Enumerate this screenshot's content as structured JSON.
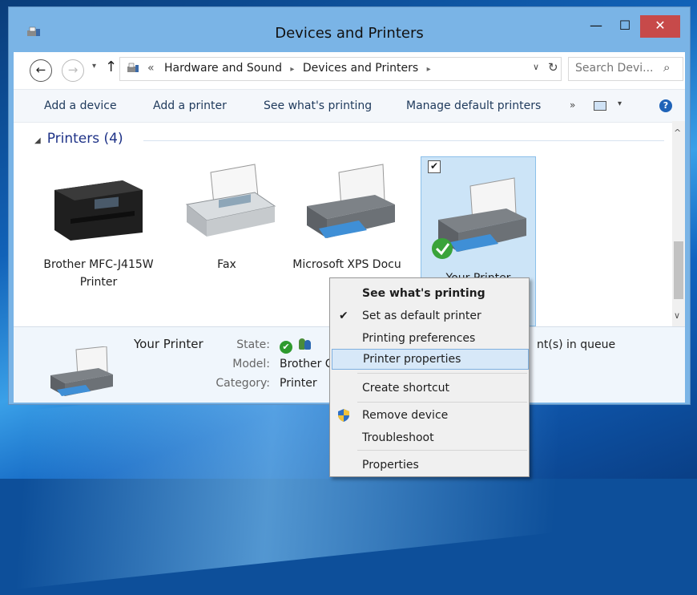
{
  "window": {
    "title": "Devices and Printers",
    "minimize": "—",
    "maximize": "☐",
    "close": "✕"
  },
  "address": {
    "back": "←",
    "forward": "→",
    "recent": "▾",
    "up": "↑",
    "overflow": "«",
    "crumbs": [
      "Hardware and Sound",
      "Devices and Printers"
    ],
    "crumb_sep": "▸",
    "dropdown": "∨",
    "refresh": "↻",
    "search_placeholder": "Search Devi...",
    "search_icon": "⌕"
  },
  "commands": {
    "add_device": "Add a device",
    "add_printer": "Add a printer",
    "see_printing": "See what's printing",
    "manage_default": "Manage default printers",
    "more": "»",
    "view_dd": "▾",
    "help": "?"
  },
  "group": {
    "label": "Printers (4)",
    "toggle": "◢"
  },
  "scroll": {
    "up": "^",
    "down": "∨"
  },
  "devices": [
    {
      "label": "Brother MFC-J415W Printer",
      "icon": "mfp-printer-icon"
    },
    {
      "label": "Fax",
      "icon": "fax-icon"
    },
    {
      "label": "Microsoft XPS Docu",
      "icon": "printer-icon"
    },
    {
      "label": "Your Printer",
      "icon": "printer-icon",
      "selected": true,
      "default": true
    }
  ],
  "details": {
    "name": "Your Printer",
    "state_label": "State:",
    "model_label": "Model:",
    "category_label": "Category:",
    "model_value": "Brother C",
    "category_value": "Printer",
    "queue_text": "nt(s) in queue"
  },
  "context_menu": {
    "items": [
      {
        "label": "See what's printing",
        "bold": true
      },
      {
        "label": "Set as default printer",
        "checked": true
      },
      {
        "label": "Printing preferences"
      },
      {
        "label": "Printer properties",
        "hovered": true
      },
      {
        "label": "Create shortcut"
      },
      {
        "label": "Remove device",
        "icon": "shield-icon"
      },
      {
        "label": "Troubleshoot"
      },
      {
        "label": "Properties"
      }
    ],
    "check_glyph": "✔"
  },
  "colors": {
    "accent": "#1e3287",
    "selection": "#cce4f7",
    "close_button": "#c74a4a",
    "titlebar": "#7ab4e6"
  }
}
